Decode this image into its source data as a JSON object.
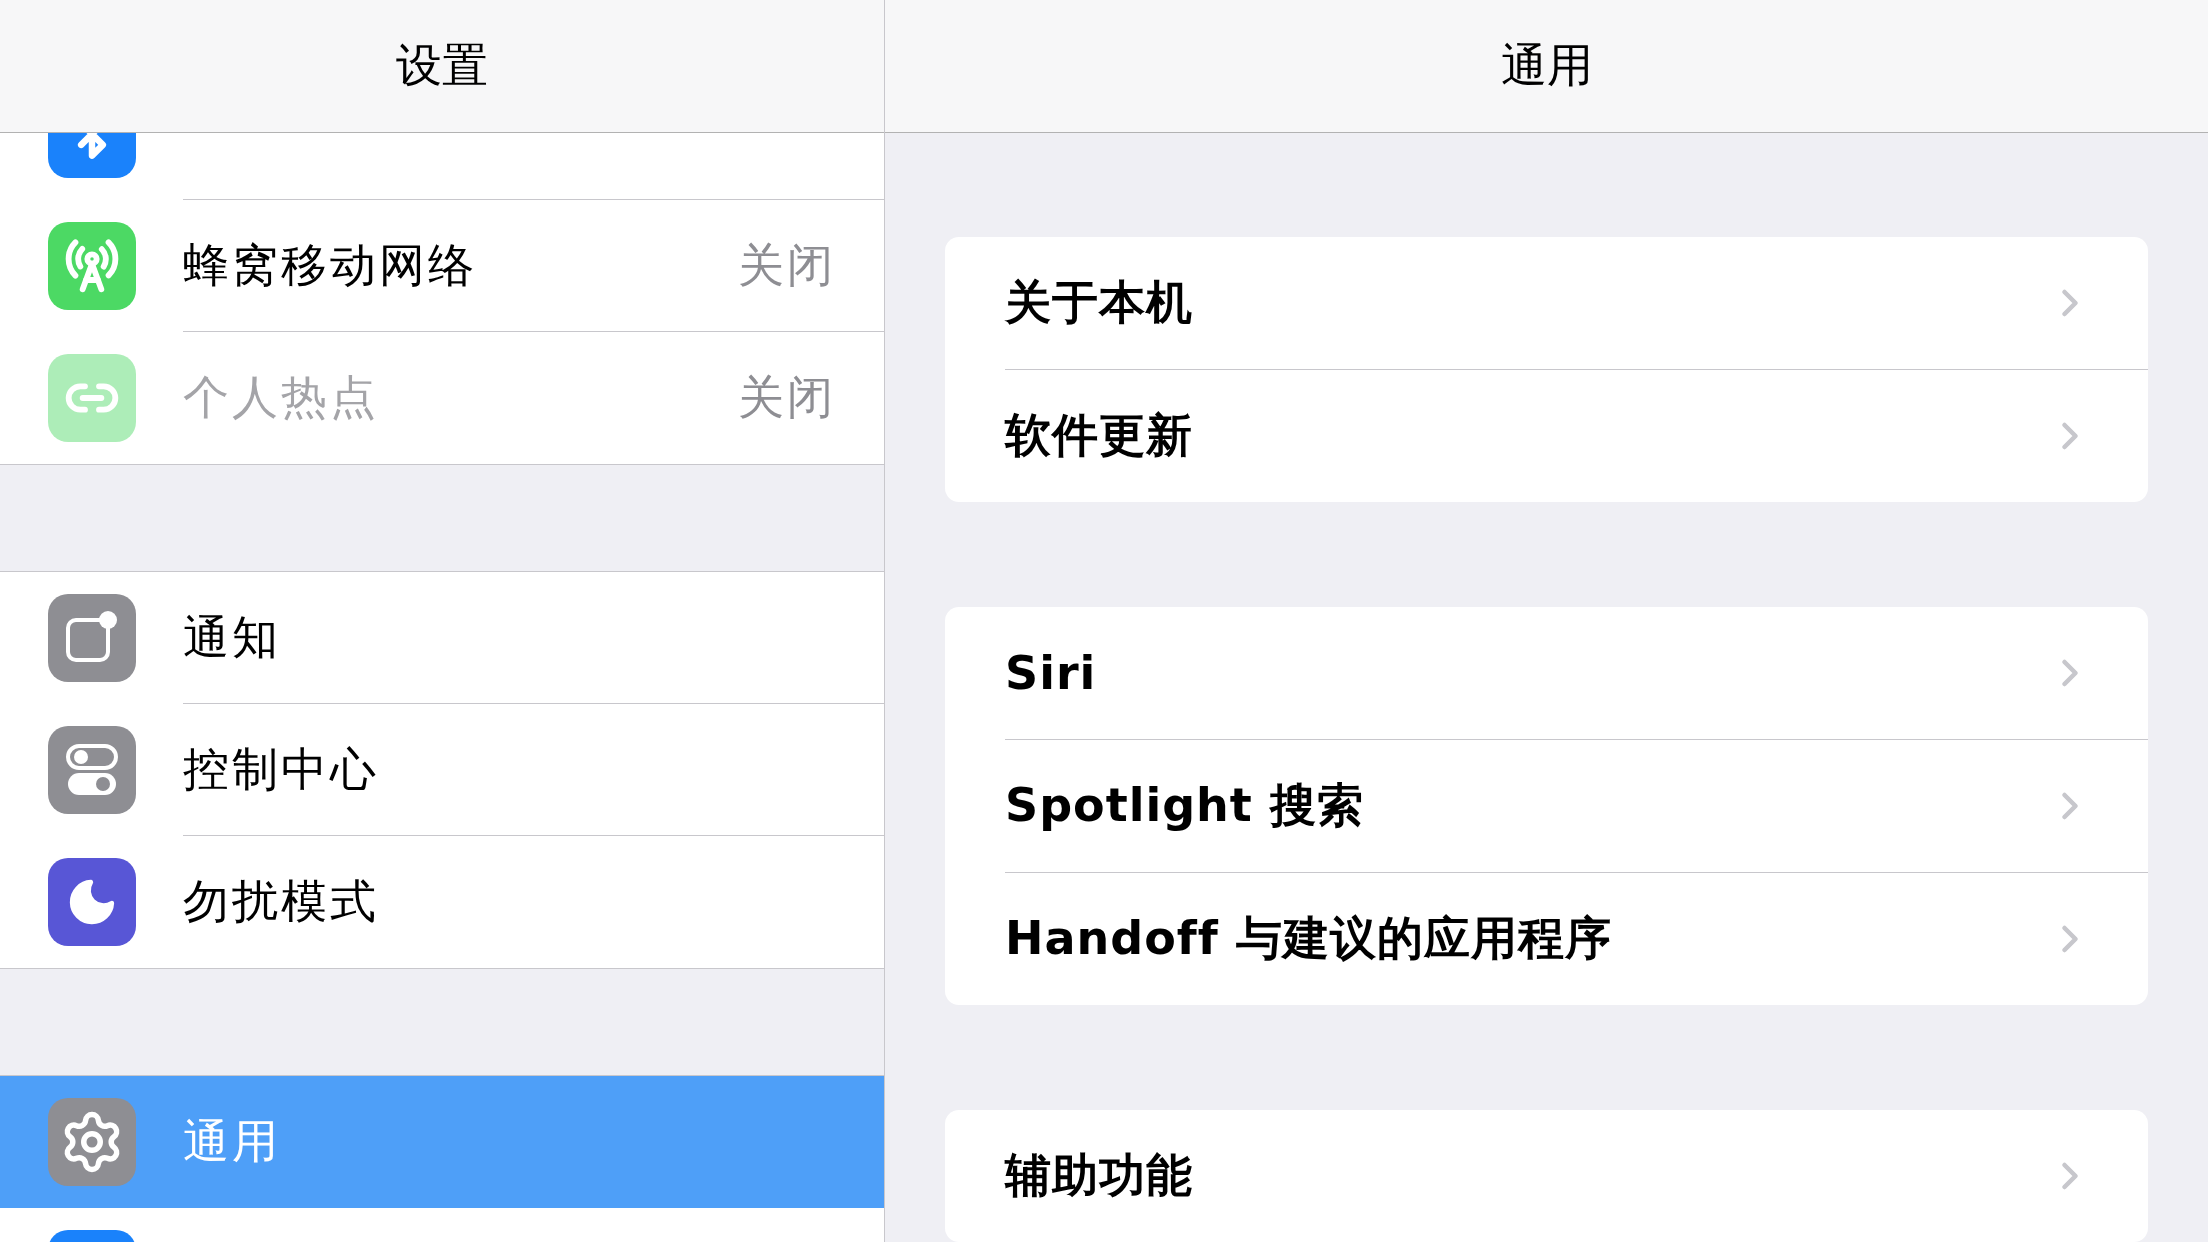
{
  "sidebar": {
    "title": "设置",
    "sections": [
      {
        "items": [
          {
            "selected": false,
            "disabled": false
          },
          {
            "label": "蜂窝移动网络",
            "value": "关闭",
            "selected": false,
            "disabled": false
          },
          {
            "label": "个人热点",
            "value": "关闭",
            "selected": false,
            "disabled": true
          }
        ]
      },
      {
        "items": [
          {
            "label": "通知",
            "selected": false,
            "disabled": false
          },
          {
            "label": "控制中心",
            "selected": false,
            "disabled": false
          },
          {
            "label": "勿扰模式",
            "selected": false,
            "disabled": false
          }
        ]
      },
      {
        "items": [
          {
            "label": "通用",
            "selected": true,
            "disabled": false
          },
          {
            "selected": false,
            "disabled": false
          }
        ]
      }
    ]
  },
  "detail": {
    "title": "通用",
    "groups": [
      {
        "rows": [
          {
            "label": "关于本机"
          },
          {
            "label": "软件更新"
          }
        ]
      },
      {
        "rows": [
          {
            "label": "Siri"
          },
          {
            "label": "Spotlight 搜索"
          },
          {
            "label": "Handoff 与建议的应用程序"
          }
        ]
      },
      {
        "rows": [
          {
            "label": "辅助功能"
          }
        ]
      }
    ]
  }
}
